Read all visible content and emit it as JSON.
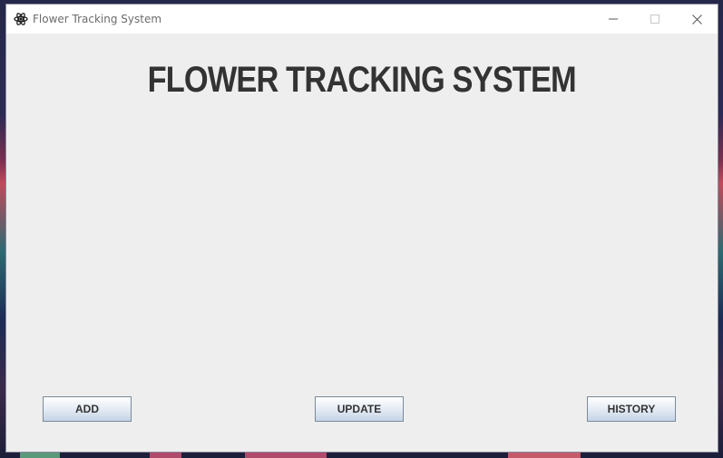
{
  "window": {
    "title": "Flower Tracking System",
    "icon": "flower-app-icon"
  },
  "main": {
    "heading": "FLOWER TRACKING SYSTEM"
  },
  "actions": {
    "add_label": "ADD",
    "update_label": "UPDATE",
    "history_label": "HISTORY"
  },
  "colors": {
    "window_bg": "#eeeeee",
    "heading_text": "#333333",
    "titlebar_bg": "#ffffff"
  }
}
